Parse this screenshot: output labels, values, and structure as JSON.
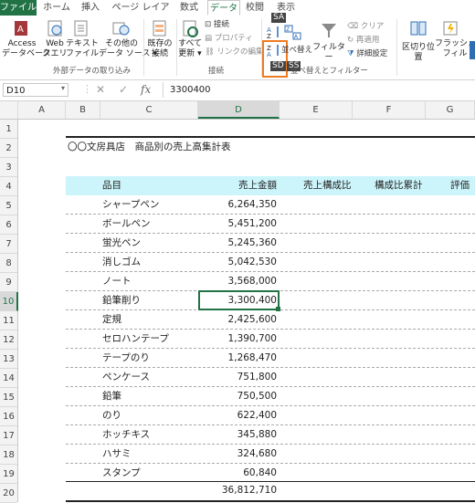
{
  "tabs": [
    "ファイル",
    "ホーム",
    "挿入",
    "ページ レイアウト",
    "数式",
    "データ",
    "校閲",
    "表示"
  ],
  "ribbon": {
    "access": "Access\nデータベース",
    "web": "Web\nクエリ",
    "text": "テキスト\nファイル",
    "other": "その他の\nデータ ソース ▾",
    "existing": "既存の\n接続",
    "refresh": "すべて\n更新 ▾",
    "conn_items": [
      "接続",
      "プロパティ",
      "リンクの編集"
    ],
    "sort": "並べ替え",
    "filter": "フィルター",
    "filter_items": [
      "クリア",
      "再適用",
      "詳細設定"
    ],
    "split": "区切り位置",
    "flash": "フラッシュ\nフィル",
    "group_external": "外部データの取り込み",
    "group_conn": "接続",
    "group_sort": "並べ替えとフィルター",
    "tip_sa": "SA",
    "tip_sd": "SD",
    "tip_ss": "SS"
  },
  "formula_bar": {
    "name_box": "D10",
    "fx": "fx",
    "value": "3300400"
  },
  "columns": [
    "A",
    "B",
    "C",
    "D",
    "E",
    "F",
    "G"
  ],
  "rows": [
    "1",
    "2",
    "3",
    "4",
    "5",
    "6",
    "7",
    "8",
    "9",
    "10",
    "11",
    "12",
    "13",
    "14",
    "15",
    "16",
    "17",
    "18",
    "19",
    "20"
  ],
  "sheet": {
    "title": "〇〇文房具店　商品別の売上高集計表",
    "headers": [
      "品目",
      "売上金額",
      "売上構成比",
      "構成比累計",
      "評価"
    ],
    "items": [
      {
        "name": "シャープペン",
        "amount": "6,264,350"
      },
      {
        "name": "ボールペン",
        "amount": "5,451,200"
      },
      {
        "name": "蛍光ペン",
        "amount": "5,245,360"
      },
      {
        "name": "消しゴム",
        "amount": "5,042,530"
      },
      {
        "name": "ノート",
        "amount": "3,568,000"
      },
      {
        "name": "鉛筆削り",
        "amount": "3,300,400"
      },
      {
        "name": "定規",
        "amount": "2,425,600"
      },
      {
        "name": "セロハンテープ",
        "amount": "1,390,700"
      },
      {
        "name": "テープのり",
        "amount": "1,268,470"
      },
      {
        "name": "ペンケース",
        "amount": "751,800"
      },
      {
        "name": "鉛筆",
        "amount": "750,500"
      },
      {
        "name": "のり",
        "amount": "622,400"
      },
      {
        "name": "ホッチキス",
        "amount": "345,880"
      },
      {
        "name": "ハサミ",
        "amount": "324,680"
      },
      {
        "name": "スタンプ",
        "amount": "60,840"
      }
    ],
    "total": "36,812,710"
  },
  "colors": {
    "excel_green": "#217346",
    "header_fill": "#ccf5fb",
    "highlight": "#f07c22"
  }
}
